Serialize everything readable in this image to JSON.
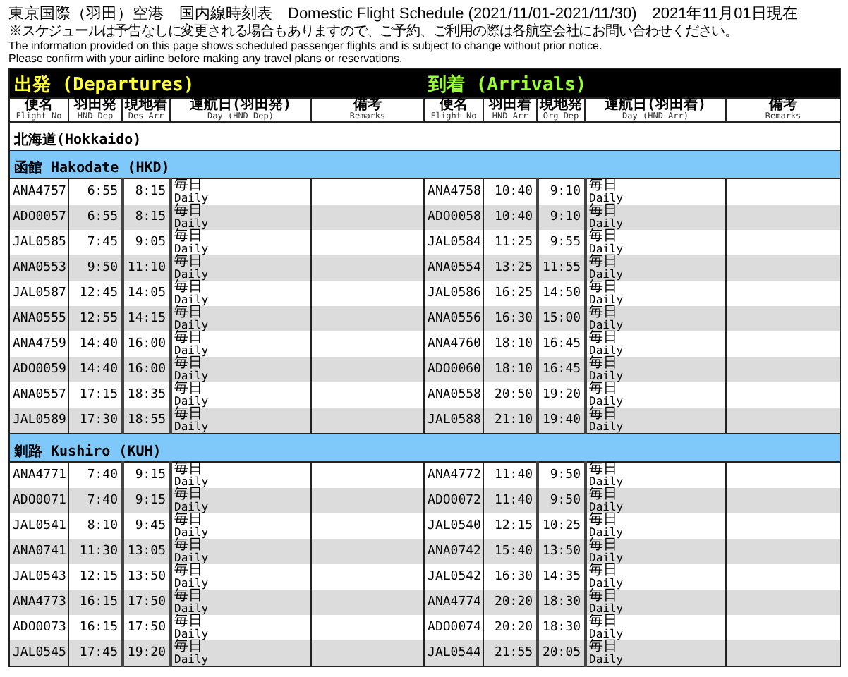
{
  "title": "東京国際（羽田）空港　国内線時刻表　Domestic Flight Schedule (2021/11/01-2021/11/30)　2021年11月01日現在",
  "notes": [
    "※スケジュールは予告なしに変更される場合もありますので、ご予約、ご利用の際は各航空会社にお問い合わせください。",
    "The information provided on this page shows scheduled passenger flights and is subject to change without prior notice.",
    "Please confirm with your airline before making any travel plans or reservations."
  ],
  "departures_label": "出発 (Departures)",
  "arrivals_label": "到着 (Arrivals)",
  "columns": [
    {
      "ja": "便名",
      "en": "Flight No"
    },
    {
      "ja": "羽田発",
      "en": "HND Dep"
    },
    {
      "ja": "現地着",
      "en": "Des Arr"
    },
    {
      "ja": "運航日(羽田発)",
      "en": "Day (HND Dep)"
    },
    {
      "ja": "備考",
      "en": "Remarks"
    },
    {
      "ja": "便名",
      "en": "Flight No"
    },
    {
      "ja": "羽田着",
      "en": "HND Arr"
    },
    {
      "ja": "現地発",
      "en": "Org Dep"
    },
    {
      "ja": "運航日(羽田着)",
      "en": "Day (HND Arr)"
    },
    {
      "ja": "備考",
      "en": "Remarks"
    }
  ],
  "region": "北海道(Hokkaido)",
  "airports": [
    {
      "name": "函館 Hakodate (HKD)",
      "rows": [
        {
          "dep": [
            "ANA4757",
            "6:55",
            "8:15",
            "毎日",
            "Daily"
          ],
          "arr": [
            "ANA4758",
            "10:40",
            "9:10",
            "毎日",
            "Daily"
          ]
        },
        {
          "dep": [
            "ADO0057",
            "6:55",
            "8:15",
            "毎日",
            "Daily"
          ],
          "arr": [
            "ADO0058",
            "10:40",
            "9:10",
            "毎日",
            "Daily"
          ]
        },
        {
          "dep": [
            "JAL0585",
            "7:45",
            "9:05",
            "毎日",
            "Daily"
          ],
          "arr": [
            "JAL0584",
            "11:25",
            "9:55",
            "毎日",
            "Daily"
          ]
        },
        {
          "dep": [
            "ANA0553",
            "9:50",
            "11:10",
            "毎日",
            "Daily"
          ],
          "arr": [
            "ANA0554",
            "13:25",
            "11:55",
            "毎日",
            "Daily"
          ]
        },
        {
          "dep": [
            "JAL0587",
            "12:45",
            "14:05",
            "毎日",
            "Daily"
          ],
          "arr": [
            "JAL0586",
            "16:25",
            "14:50",
            "毎日",
            "Daily"
          ]
        },
        {
          "dep": [
            "ANA0555",
            "12:55",
            "14:15",
            "毎日",
            "Daily"
          ],
          "arr": [
            "ANA0556",
            "16:30",
            "15:00",
            "毎日",
            "Daily"
          ]
        },
        {
          "dep": [
            "ANA4759",
            "14:40",
            "16:00",
            "毎日",
            "Daily"
          ],
          "arr": [
            "ANA4760",
            "18:10",
            "16:45",
            "毎日",
            "Daily"
          ]
        },
        {
          "dep": [
            "ADO0059",
            "14:40",
            "16:00",
            "毎日",
            "Daily"
          ],
          "arr": [
            "ADO0060",
            "18:10",
            "16:45",
            "毎日",
            "Daily"
          ]
        },
        {
          "dep": [
            "ANA0557",
            "17:15",
            "18:35",
            "毎日",
            "Daily"
          ],
          "arr": [
            "ANA0558",
            "20:50",
            "19:20",
            "毎日",
            "Daily"
          ]
        },
        {
          "dep": [
            "JAL0589",
            "17:30",
            "18:55",
            "毎日",
            "Daily"
          ],
          "arr": [
            "JAL0588",
            "21:10",
            "19:40",
            "毎日",
            "Daily"
          ]
        }
      ]
    },
    {
      "name": "釧路 Kushiro (KUH)",
      "rows": [
        {
          "dep": [
            "ANA4771",
            "7:40",
            "9:15",
            "毎日",
            "Daily"
          ],
          "arr": [
            "ANA4772",
            "11:40",
            "9:50",
            "毎日",
            "Daily"
          ]
        },
        {
          "dep": [
            "ADO0071",
            "7:40",
            "9:15",
            "毎日",
            "Daily"
          ],
          "arr": [
            "ADO0072",
            "11:40",
            "9:50",
            "毎日",
            "Daily"
          ]
        },
        {
          "dep": [
            "JAL0541",
            "8:10",
            "9:45",
            "毎日",
            "Daily"
          ],
          "arr": [
            "JAL0540",
            "12:15",
            "10:25",
            "毎日",
            "Daily"
          ]
        },
        {
          "dep": [
            "ANA0741",
            "11:30",
            "13:05",
            "毎日",
            "Daily"
          ],
          "arr": [
            "ANA0742",
            "15:40",
            "13:50",
            "毎日",
            "Daily"
          ]
        },
        {
          "dep": [
            "JAL0543",
            "12:15",
            "13:50",
            "毎日",
            "Daily"
          ],
          "arr": [
            "JAL0542",
            "16:30",
            "14:35",
            "毎日",
            "Daily"
          ]
        },
        {
          "dep": [
            "ANA4773",
            "16:15",
            "17:50",
            "毎日",
            "Daily"
          ],
          "arr": [
            "ANA4774",
            "20:20",
            "18:30",
            "毎日",
            "Daily"
          ]
        },
        {
          "dep": [
            "ADO0073",
            "16:15",
            "17:50",
            "毎日",
            "Daily"
          ],
          "arr": [
            "ADO0074",
            "20:20",
            "18:30",
            "毎日",
            "Daily"
          ]
        },
        {
          "dep": [
            "JAL0545",
            "17:45",
            "19:20",
            "毎日",
            "Daily"
          ],
          "arr": [
            "JAL0544",
            "21:55",
            "20:05",
            "毎日",
            "Daily"
          ]
        }
      ]
    }
  ]
}
